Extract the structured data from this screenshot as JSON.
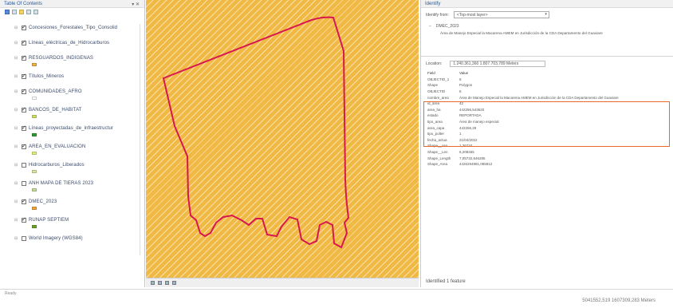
{
  "toc": {
    "title": "Table Of Contents",
    "pin": "▾ ✕",
    "layers": [
      {
        "label": "Concesiones_Forestales_Tipo_Consolid",
        "checked": true
      },
      {
        "label": "Líneas_eléctricas_de_Hidrocarburos",
        "checked": true
      },
      {
        "label": "RESGUARDOS_INDIGENAS",
        "checked": true,
        "swatch": "#f3b043"
      },
      {
        "label": "Títulos_Mineros",
        "checked": true
      },
      {
        "label": "COMUNIDADES_AFRO",
        "checked": true,
        "swatch": "#ffffff"
      },
      {
        "label": "BANCOS_DE_HABITAT",
        "checked": true,
        "swatch": "#c9e06b"
      },
      {
        "label": "Líneas_proyectadas_de_infraestructur",
        "checked": true,
        "swatch": "#2e9b2e"
      },
      {
        "label": "AREA_EN_EVALUACION",
        "checked": true,
        "swatch": "#e2ee7a"
      },
      {
        "label": "Hidrocarburos_Liberados",
        "checked": false,
        "swatch": "#d8ea9a"
      },
      {
        "label": "ANH MAPA DE TIERAS 2023",
        "checked": false,
        "swatch": "#c5dd9a"
      },
      {
        "label": "DMEC_2023",
        "checked": true,
        "swatch": "#f0a63a"
      },
      {
        "label": "RUNAP SEPTIEM",
        "checked": true,
        "swatch": "#6aa52b"
      },
      {
        "label": "World Imagery (WGS84)",
        "checked": false
      }
    ]
  },
  "map": {
    "fill_color": "#f0b944",
    "polygon_color": "#d8164f"
  },
  "identify": {
    "title": "Identify",
    "identify_from_label": "Identify from:",
    "identify_from_value": "<Top-most layer>",
    "tree_layer": "DMEC_2023",
    "tree_feature": "Área de Manejo Especial la Macarena AMEM en Jurisdicción de la CDA Departamento del Guaviare",
    "location_label": "Location:",
    "location_value": "1.240.361,360  1.807.703,789 Meters",
    "header": {
      "field": "Field",
      "value": "Value"
    },
    "attributes": [
      {
        "field": "OBJECTID_1",
        "value": "6"
      },
      {
        "field": "Shape",
        "value": "Polygon"
      },
      {
        "field": "OBJECTID",
        "value": "6"
      },
      {
        "field": "nombre_area",
        "value": "Área de Manejo Especial la Macarena AMEM en Jurisdicción de la CDA Departamento del Guaviare"
      },
      {
        "field": "id_area",
        "value": "42"
      },
      {
        "field": "area_ha",
        "value": "442256,543620"
      },
      {
        "field": "estado",
        "value": "REPORTADA"
      },
      {
        "field": "tipo_area",
        "value": "Área de manejo especial"
      },
      {
        "field": "area_capa",
        "value": "442256,29"
      },
      {
        "field": "tipo_polter",
        "value": "1"
      },
      {
        "field": "fecha_actua",
        "value": "21/04/2022"
      },
      {
        "field": "Shape__Are",
        "value": "1,36734"
      },
      {
        "field": "Shape__Len",
        "value": "6,208465"
      },
      {
        "field": "Shape_Length",
        "value": "7,05732,546285"
      },
      {
        "field": "Shape_Area",
        "value": "4426294981,085812"
      }
    ],
    "footer": "Identified 1 feature"
  },
  "status": {
    "left": "Ready",
    "coords": "5041552,519  1607309,283 Meters"
  }
}
